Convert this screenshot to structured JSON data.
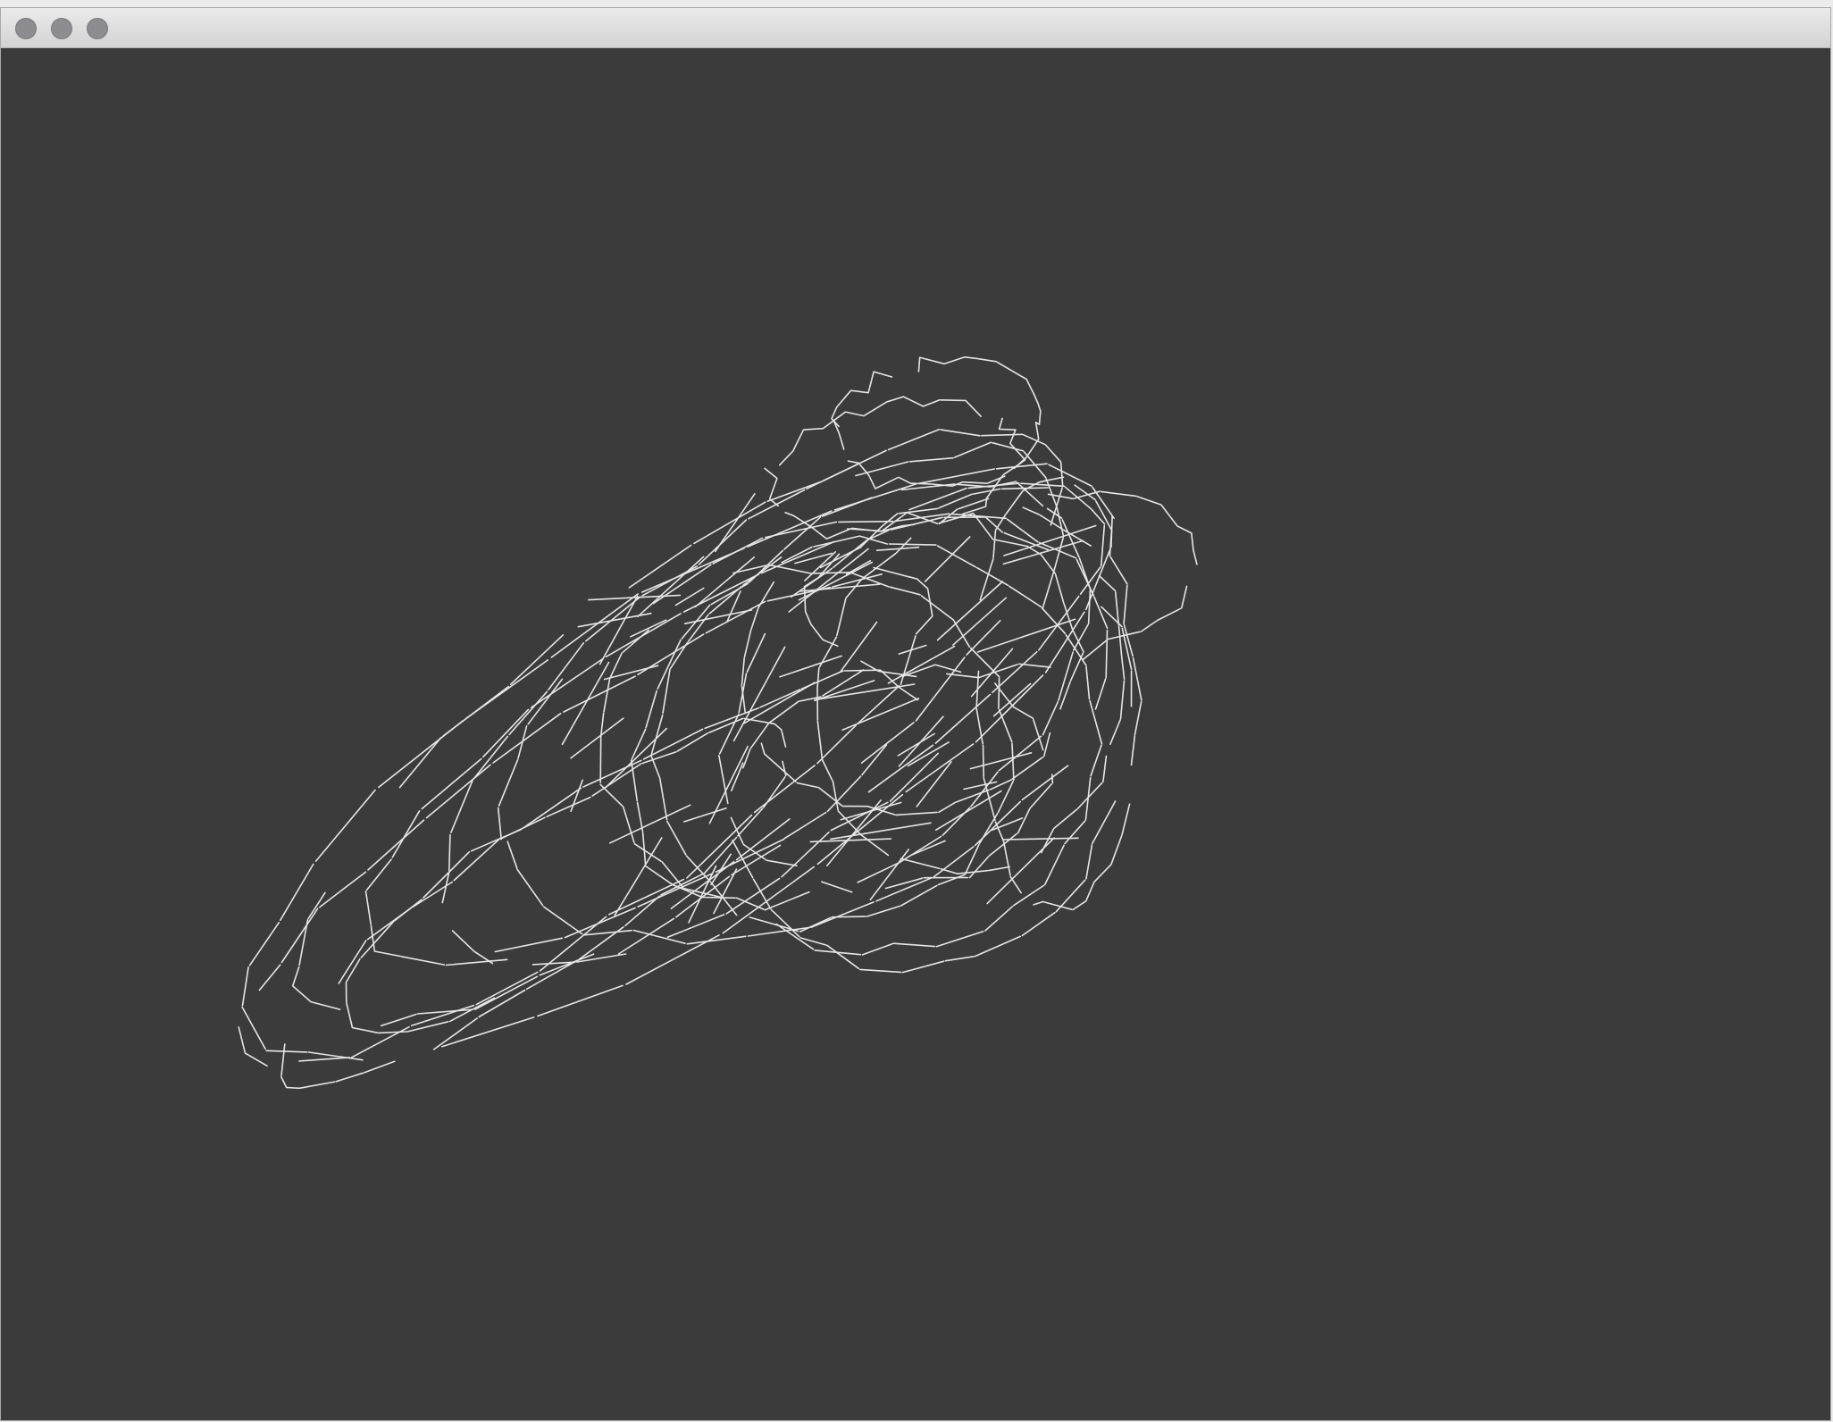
{
  "window": {
    "title": "",
    "buttons": [
      {
        "name": "close",
        "icon": "close-circle-icon"
      },
      {
        "name": "minimize",
        "icon": "minimize-circle-icon"
      },
      {
        "name": "zoom",
        "icon": "zoom-circle-icon"
      }
    ]
  },
  "canvas": {
    "background": "#3b3b3b",
    "stroke_color": "#e6e6e6",
    "drawing": "wireframe-lines"
  }
}
